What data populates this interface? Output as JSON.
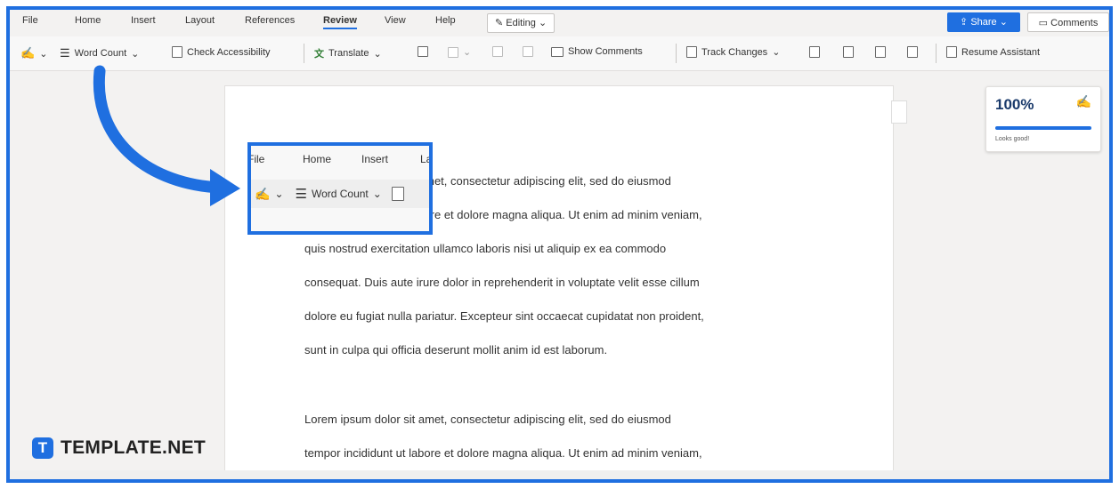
{
  "menu": {
    "tabs": [
      "File",
      "Home",
      "Insert",
      "Layout",
      "References",
      "Review",
      "View",
      "Help"
    ],
    "active_tab": "Review",
    "editing_label": "Editing",
    "share_label": "Share",
    "comments_label": "Comments"
  },
  "ribbon": {
    "word_count": "Word Count",
    "check_accessibility": "Check Accessibility",
    "translate": "Translate",
    "show_comments": "Show Comments",
    "track_changes": "Track Changes",
    "resume_assistant": "Resume Assistant"
  },
  "editor_score": {
    "value": "100%",
    "message": "Looks good!"
  },
  "zoom_callout": {
    "tabs": [
      "File",
      "Home",
      "Insert",
      "La"
    ],
    "word_count": "Word Count"
  },
  "document": {
    "paragraphs": [
      [
        "Lorem ipsum dolor sit amet, consectetur adipiscing elit, sed do eiusmod",
        "tempor incididunt ut labore et dolore magna aliqua. Ut enim ad minim veniam,",
        "quis nostrud exercitation ullamco laboris nisi ut aliquip ex ea commodo",
        "consequat. Duis aute irure dolor in reprehenderit in voluptate velit esse cillum",
        "dolore eu fugiat nulla pariatur. Excepteur sint occaecat cupidatat non proident,",
        "sunt in culpa qui officia deserunt mollit anim id est laborum."
      ],
      [
        "Lorem ipsum dolor sit amet, consectetur adipiscing elit, sed do eiusmod",
        "tempor incididunt ut labore et dolore magna aliqua. Ut enim ad minim veniam,"
      ]
    ]
  },
  "watermark": {
    "brand": "TEMPLATE.NET",
    "mark": "T"
  },
  "colors": {
    "accent": "#1f6fe0"
  }
}
